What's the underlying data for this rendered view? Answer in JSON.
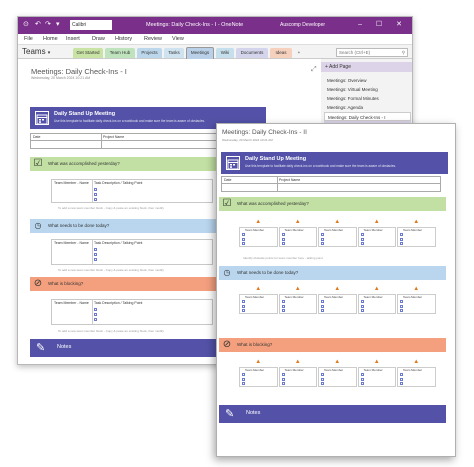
{
  "app": {
    "font_box": "Calibri",
    "window_title": "Meetings: Daily Check-Ins - I - OneNote",
    "user": "Auscomp Developer",
    "window_buttons": "– ☐ ✕",
    "quick_access": [
      "⊙",
      "↶",
      "↷",
      "▾"
    ]
  },
  "menu": [
    "File",
    "Home",
    "Insert",
    "Draw",
    "History",
    "Review",
    "View"
  ],
  "notebook": {
    "name": "Teams",
    "chevron": "▾"
  },
  "section_tabs": [
    {
      "label": "Get Started",
      "color": "#c9e3a4"
    },
    {
      "label": "Team Hub",
      "color": "#bfe3bd"
    },
    {
      "label": "Projects",
      "color": "#bcd7ec"
    },
    {
      "label": "Tasks",
      "color": "#cfe2ef"
    },
    {
      "label": "Meetings",
      "color": "#b9d0e8"
    },
    {
      "label": "Wiki",
      "color": "#c6dfec"
    },
    {
      "label": "Documents",
      "color": "#d4d4ec"
    },
    {
      "label": "Ideas",
      "color": "#f4d0bd"
    },
    {
      "label": "+",
      "color": "#f3f3f3"
    }
  ],
  "search": {
    "placeholder": "Search (Ctrl+E)",
    "icon": "search-icon"
  },
  "pages": {
    "add_label": "+ Add Page",
    "items": [
      "Meetings: Overview",
      "Meetings: Virtual Meeting",
      "Meetings: Formal Minutes",
      "Meetings: Agenda",
      "Meetings: Daily Check-Ins - I",
      "Meetings: Daily Check-Ins - II"
    ]
  },
  "page1": {
    "title": "Meetings: Daily Check-Ins - I",
    "date": "Wednesday, 20 March 2024     10:21 AM",
    "expand_icon": "⤢",
    "banner_title": "Daily Stand Up Meeting",
    "banner_sub": "Use this template to facilitate daily check-ins on a workbook and make sure the team is aware of obstacles.",
    "date_label": "Date",
    "project_label": "Project Name",
    "sections": [
      {
        "title": "What was accomplished yesterday?",
        "icon": "☑",
        "color": "#c2e0a3"
      },
      {
        "title": "What needs to be done today?",
        "icon": "🕓",
        "color": "#b9d6ee"
      },
      {
        "title": "What is blocking?",
        "icon": "⊘",
        "color": "#f4a07e"
      }
    ],
    "col_member": "Team Member - Name",
    "col_task": "Task Description / Talking Point",
    "hint": "To add a new team member block - Copy & paste an existing block, then modify",
    "notes": "Notes"
  },
  "page2": {
    "title": "Meetings: Daily Check-Ins - II",
    "date": "Wednesday, 20 March 2024     10:21 AM",
    "banner_title": "Daily Stand Up Meeting",
    "banner_sub": "Use this template to facilitate daily check-ins on a workbook and make sure the team is aware of obstacles.",
    "date_label": "Date",
    "project_label": "Project Name",
    "sections": [
      {
        "title": "What was accomplished yesterday?",
        "icon": "☑",
        "color": "#c2e0a3"
      },
      {
        "title": "What needs to be done today?",
        "icon": "🕓",
        "color": "#b9d6ee"
      },
      {
        "title": "What is blocking?",
        "icon": "⊘",
        "color": "#f4a07e"
      }
    ],
    "member_label": "Team Member",
    "hint": "Identify obstacle points for team member here - talking point",
    "notes": "Notes"
  },
  "colors": {
    "brand": "#7a2f8a",
    "banner": "#5352a8"
  }
}
